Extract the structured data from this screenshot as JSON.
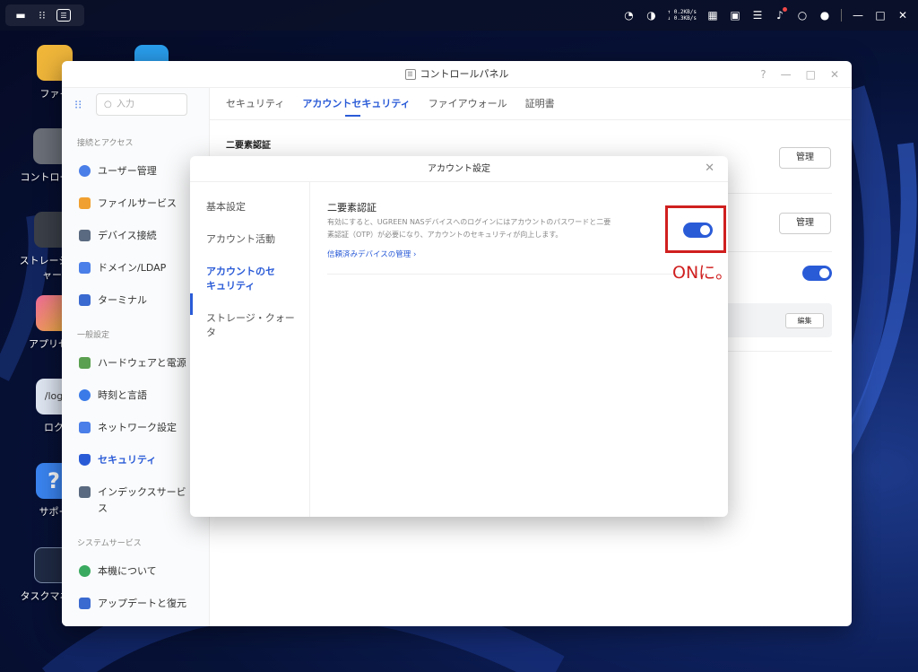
{
  "desktop": {
    "icons": [
      {
        "label": "ファイ",
        "color": "#f0b63a"
      },
      {
        "label": "コントロー",
        "color": "#6a6f78"
      },
      {
        "label": "ストレージ",
        "label2": "ャー",
        "color": "#3a3f48"
      },
      {
        "label": "アプリセ",
        "color": "#e85a9a"
      },
      {
        "label": "/log",
        "label2": "ロク",
        "color": "#dfe6f2"
      },
      {
        "label": "サポー",
        "color": "#3a84f0"
      },
      {
        "label": "タスクマネ",
        "color": "#1f2a44"
      }
    ]
  },
  "topbar": {
    "net_up": "↑ 0.2KB/s",
    "net_down": "↓ 0.3KB/s",
    "cpu_label": "CPU",
    "ram_label": "RAM"
  },
  "window": {
    "title": "コントロールパネル",
    "search_placeholder": "入力",
    "sections": {
      "connection": "接続とアクセス",
      "general": "一般設定",
      "system": "システムサービス"
    },
    "sidebar_items": [
      {
        "label": "ユーザー管理",
        "color": "#4a7ee8"
      },
      {
        "label": "ファイルサービス",
        "color": "#f0a030"
      },
      {
        "label": "デバイス接続",
        "color": "#5a6a80"
      },
      {
        "label": "ドメイン/LDAP",
        "color": "#4a7ee8"
      },
      {
        "label": "ターミナル",
        "color": "#3a6ad0"
      },
      {
        "label": "ハードウェアと電源",
        "color": "#5aa050"
      },
      {
        "label": "時刻と言語",
        "color": "#3a7ae8"
      },
      {
        "label": "ネットワーク設定",
        "color": "#4a7ee8"
      },
      {
        "label": "セキュリティ",
        "color": "#2a5bd7"
      },
      {
        "label": "インデックスサービ",
        "label2": "ス",
        "color": "#5a6a80"
      },
      {
        "label": "本機について",
        "color": "#3aaa60"
      },
      {
        "label": "アップデートと復元",
        "color": "#3a6ad0"
      }
    ],
    "tabs": [
      "セキュリティ",
      "アカウントセキュリティ",
      "ファイアウォール",
      "証明書"
    ],
    "section_title": "二要素認証",
    "manage_label": "管理",
    "manage_label_2": "管理",
    "edit_label": "編集"
  },
  "dialog": {
    "title": "アカウント設定",
    "nav": [
      "基本設定",
      "アカウント活動",
      "アカウントのセ",
      "キュリティ",
      "ストレージ・クォー",
      "タ"
    ],
    "option_title": "二要素認証",
    "option_desc_1": "有効にすると、UGREEN NASデバイスへのログインにはアカウントのパスワードと二要",
    "option_desc_2": "素認証（OTP）が必要になり、アカウントのセキュリティが向上します。",
    "option_link": "信頼済みデバイスの管理 ›",
    "toggle_state": "on"
  },
  "annotation": {
    "text": "ONに。",
    "color": "#d01f1f"
  }
}
